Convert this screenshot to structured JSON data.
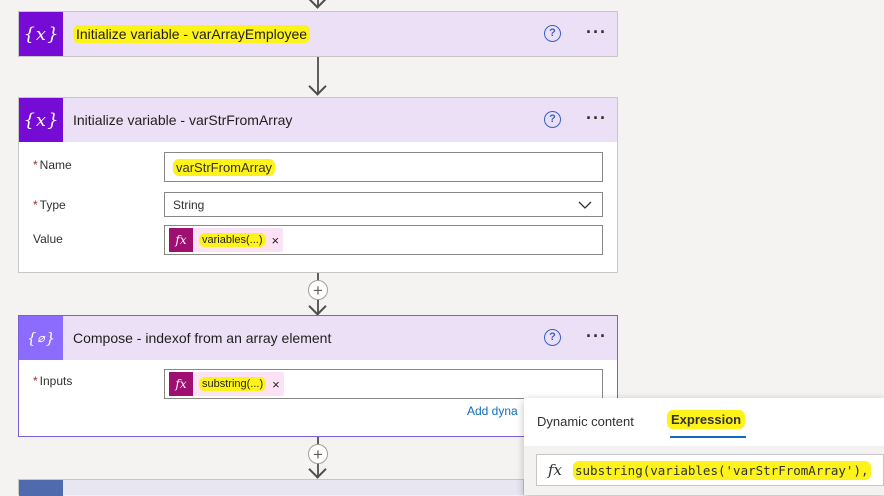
{
  "cards": {
    "init_array": {
      "title": "Initialize variable - varArrayEmployee"
    },
    "init_str": {
      "title": "Initialize variable - varStrFromArray",
      "name_label": "Name",
      "name_value": "varStrFromArray",
      "type_label": "Type",
      "type_value": "String",
      "value_label": "Value",
      "value_token": "variables(...)"
    },
    "compose": {
      "title": "Compose - indexof from an array element",
      "inputs_label": "Inputs",
      "inputs_token": "substring(...)",
      "add_dynamic": "Add dyna"
    }
  },
  "required_mark": "*",
  "token_fx": "fx",
  "token_remove": "×",
  "help_glyph": "?",
  "more_glyph": "···",
  "popup": {
    "tab_dynamic": "Dynamic content",
    "tab_expression": "Expression",
    "fx_label": "fx",
    "expression_text": "substring(variables('varStrFromArray'),"
  },
  "colors": {
    "variable_icon_bg": "#770bd6",
    "compose_icon_bg": "#8c6cff",
    "header_bg": "#ebe0f5",
    "token_bg": "#9e0f6f",
    "highlight": "#fdf21a"
  },
  "icons": {
    "variable": "curly-x-icon",
    "compose": "curly-compose-icon",
    "help": "help-icon",
    "more": "more-options-icon"
  }
}
